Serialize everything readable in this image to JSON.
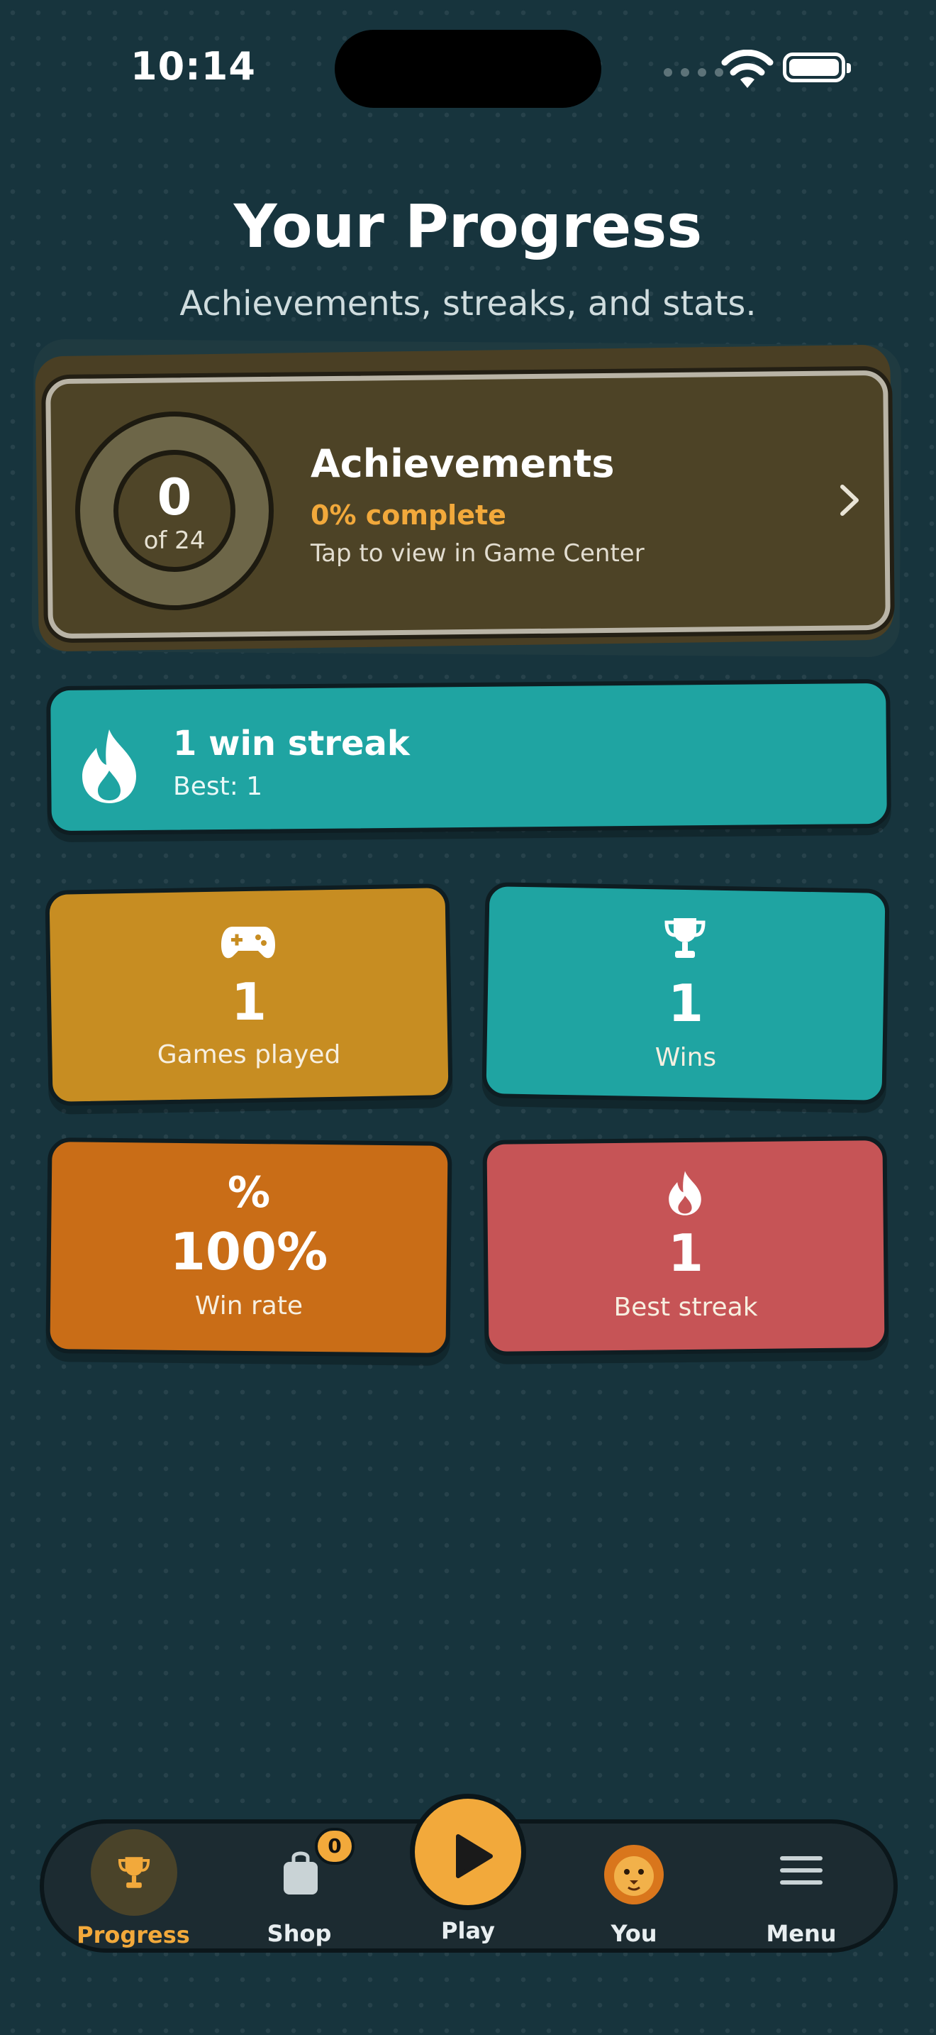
{
  "status_bar": {
    "time": "10:14"
  },
  "header": {
    "title": "Your Progress",
    "subtitle": "Achievements, streaks, and stats."
  },
  "achievements": {
    "count": "0",
    "of_total": "of 24",
    "title": "Achievements",
    "percent": "0% complete",
    "hint": "Tap to view in Game Center",
    "chevron_icon": "chevron-right-icon"
  },
  "streak": {
    "icon": "flame-icon",
    "title": "1 win streak",
    "best": "Best: 1"
  },
  "stats": [
    {
      "icon": "gamepad-icon",
      "value": "1",
      "label": "Games played",
      "color": "#c78d22"
    },
    {
      "icon": "trophy-icon",
      "value": "1",
      "label": "Wins",
      "color": "#1fa4a2"
    },
    {
      "icon_text": "%",
      "value": "100%",
      "label": "Win rate",
      "color": "#c96d17"
    },
    {
      "icon": "flame-icon",
      "value": "1",
      "label": "Best streak",
      "color": "#c65456"
    }
  ],
  "tab_bar": {
    "items": [
      {
        "label": "Progress",
        "icon": "trophy-icon",
        "active": true
      },
      {
        "label": "Shop",
        "icon": "shopping-bag-icon",
        "badge": "0"
      },
      {
        "label": "Play",
        "icon": "play-icon"
      },
      {
        "label": "You",
        "icon": "lion-avatar-icon"
      },
      {
        "label": "Menu",
        "icon": "menu-icon"
      }
    ]
  },
  "colors": {
    "background": "#17343d",
    "accent": "#f2a93b",
    "teal": "#1fa4a2"
  }
}
